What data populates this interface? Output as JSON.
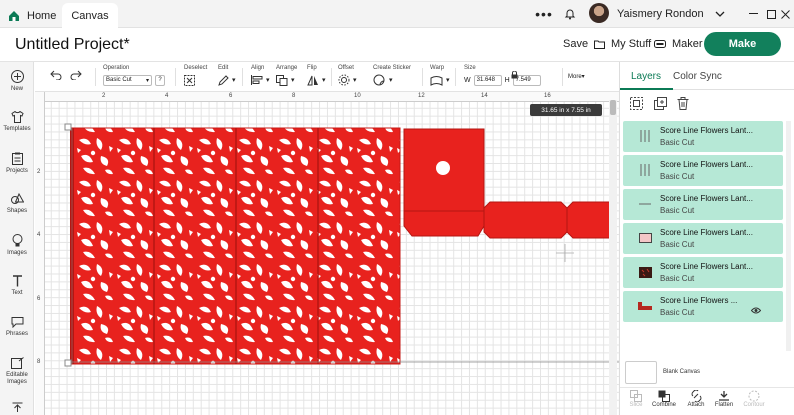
{
  "titlebar": {
    "tabs": [
      {
        "label": "Home"
      },
      {
        "label": "Canvas"
      }
    ],
    "username": "Yaismery Rondon"
  },
  "project": {
    "title": "Untitled Project*",
    "save_label": "Save",
    "mystuff_label": "My Stuff",
    "maker_label": "Maker",
    "make_label": "Make"
  },
  "sidebar": {
    "items": [
      {
        "label": "New",
        "icon": "plus-circle-icon"
      },
      {
        "label": "Templates",
        "icon": "shirt-icon"
      },
      {
        "label": "Projects",
        "icon": "clipboard-icon"
      },
      {
        "label": "Shapes",
        "icon": "shapes-icon"
      },
      {
        "label": "Images",
        "icon": "bulb-icon"
      },
      {
        "label": "Text",
        "icon": "text-icon"
      },
      {
        "label": "Phrases",
        "icon": "speech-icon"
      },
      {
        "label": "Editable Images",
        "icon": "edit-image-icon"
      }
    ]
  },
  "toolbar": {
    "operation_label": "Operation",
    "operation_value": "Basic Cut",
    "deselect_label": "Deselect",
    "edit_label": "Edit",
    "align_label": "Align",
    "arrange_label": "Arrange",
    "flip_label": "Flip",
    "offset_label": "Offset",
    "create_sticker_label": "Create Sticker",
    "warp_label": "Warp",
    "size_label": "Size",
    "width_prefix": "W",
    "width_value": "31.648",
    "height_prefix": "H",
    "height_value": "7.549",
    "more_label": "More"
  },
  "rulers": {
    "top": [
      "2",
      "4",
      "6",
      "8",
      "10",
      "12",
      "14",
      "16"
    ],
    "left": [
      "2",
      "4",
      "6",
      "8"
    ]
  },
  "canvas": {
    "size_tooltip": "31.65  in x 7.55  in",
    "cut_color": "#e8221e"
  },
  "panel": {
    "tabs": [
      {
        "label": "Layers"
      },
      {
        "label": "Color Sync"
      }
    ],
    "layers": [
      {
        "name": "Score Line Flowers Lant...",
        "operation": "Basic Cut",
        "thumb": "score-lines-vertical-icon"
      },
      {
        "name": "Score Line Flowers Lant...",
        "operation": "Basic Cut",
        "thumb": "score-lines-vertical-icon"
      },
      {
        "name": "Score Line Flowers Lant...",
        "operation": "Basic Cut",
        "thumb": "score-line-horizontal-icon"
      },
      {
        "name": "Score Line Flowers Lant...",
        "operation": "Basic Cut",
        "thumb": "pink-rectangle-icon"
      },
      {
        "name": "Score Line Flowers Lant...",
        "operation": "Basic Cut",
        "thumb": "dark-panel-icon"
      },
      {
        "name": "Score Line Flowers ...",
        "operation": "Basic Cut",
        "thumb": "red-shape-icon",
        "visible_eye": true
      }
    ],
    "blank_canvas_label": "Blank Canvas",
    "bottom_tools": [
      {
        "label": "Slice",
        "disabled": true
      },
      {
        "label": "Combine",
        "disabled": false
      },
      {
        "label": "Attach",
        "disabled": false
      },
      {
        "label": "Flatten",
        "disabled": false
      },
      {
        "label": "Contour",
        "disabled": true
      }
    ],
    "accent_color": "#0b7a55",
    "layer_bg_color": "#b6e8d6"
  }
}
